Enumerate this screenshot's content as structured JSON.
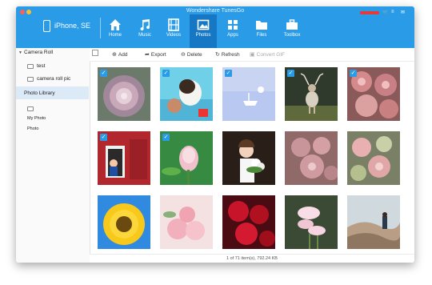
{
  "app": {
    "title": "Wondershare TunesGo"
  },
  "device": {
    "name": "iPhone, SE"
  },
  "nav": [
    {
      "label": "Home"
    },
    {
      "label": "Music"
    },
    {
      "label": "Videos"
    },
    {
      "label": "Photos",
      "active": true
    },
    {
      "label": "Apps"
    },
    {
      "label": "Files"
    },
    {
      "label": "Toolbox"
    }
  ],
  "sidebar": {
    "camera_roll": "Camera Roll",
    "items": [
      {
        "label": "test"
      },
      {
        "label": "camera roll pic"
      }
    ],
    "photo_library": "Photo Library",
    "my_photo": "My Photo",
    "photo": "Photo"
  },
  "toolbar": {
    "add": "Add",
    "export": "Export",
    "delete": "Delete",
    "refresh": "Refresh",
    "convert_gif": "Convert GIF"
  },
  "photos": [
    {
      "subject": "succulent",
      "selected": true
    },
    {
      "subject": "dog",
      "selected": true
    },
    {
      "subject": "boat",
      "selected": true
    },
    {
      "subject": "deer",
      "selected": true
    },
    {
      "subject": "succulents",
      "selected": true
    },
    {
      "subject": "red door",
      "selected": true
    },
    {
      "subject": "pink bud",
      "selected": true
    },
    {
      "subject": "girl with flowers",
      "selected": false
    },
    {
      "subject": "succulents",
      "selected": false
    },
    {
      "subject": "succulents",
      "selected": false
    },
    {
      "subject": "sunflower",
      "selected": false
    },
    {
      "subject": "pink roses",
      "selected": false
    },
    {
      "subject": "red roses",
      "selected": false
    },
    {
      "subject": "pink flowers",
      "selected": false
    },
    {
      "subject": "hills",
      "selected": false
    }
  ],
  "status": "1 of 71 item(s), 792.24 KB",
  "colors": {
    "titlebar": "#2a9be6",
    "active_nav": "#1678c4",
    "check": "#2a9be6"
  }
}
